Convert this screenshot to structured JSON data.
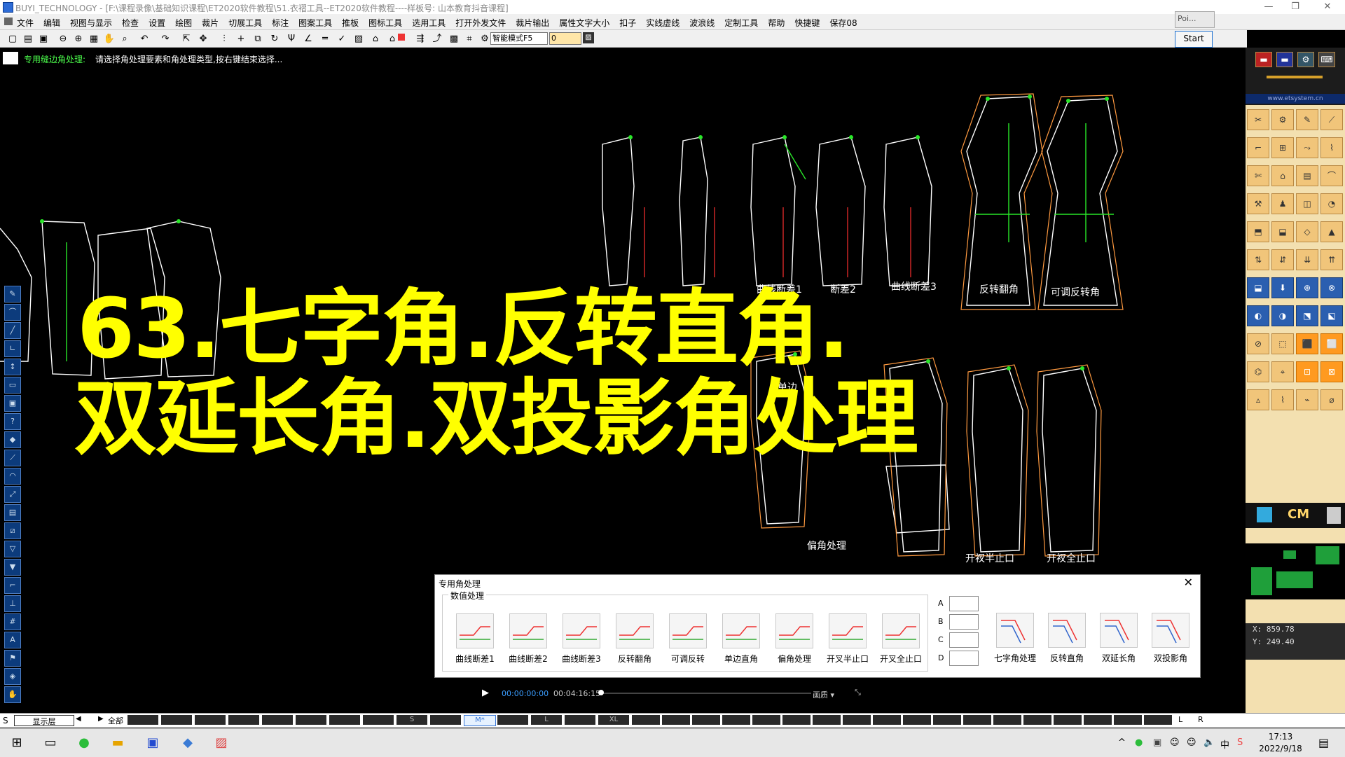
{
  "window": {
    "title": "BUYI_TECHNOLOGY - [F:\\课程录像\\基础知识课程\\ET2020软件教程\\51.衣褶工具--ET2020软件教程----样板号: 山本教育抖音课程]",
    "controls": [
      "—",
      "❐",
      "✕"
    ]
  },
  "menu": [
    "文件",
    "编辑",
    "视图与显示",
    "检查",
    "设置",
    "绘图",
    "裁片",
    "切展工具",
    "标注",
    "图案工具",
    "推板",
    "图标工具",
    "选用工具",
    "打开外发文件",
    "裁片输出",
    "属性文字大小",
    "扣子",
    "实线虚线",
    "波浪线",
    "定制工具",
    "帮助",
    "快捷键",
    "保存08"
  ],
  "toolbar": {
    "mode_select": "智能模式F5",
    "num_value": "0"
  },
  "floating": {
    "poi_label": "Poi...",
    "start_label": "Start"
  },
  "prompt": {
    "label": "专用缝边角处理:",
    "text": "请选择角处理要素和角处理类型,按右键结束选择..."
  },
  "headline": {
    "line1": "63.七字角.反转直角.",
    "line2": "双延长角.双投影角处理"
  },
  "canvas_labels": {
    "curve_diff1": "曲线断差1",
    "curve_diff2": "断差2",
    "curve_diff3": "曲线断差3",
    "flip_corner": "反转翻角",
    "adj_flip": "可调反转角",
    "single_side": "单边",
    "offset_corner": "偏角处理",
    "half_slit": "开衩半止口",
    "full_slit": "开衩全止口"
  },
  "dialog": {
    "title": "专用角处理",
    "close": "✕",
    "group_label": "数值处理",
    "buttons": [
      "曲线断差1",
      "曲线断差2",
      "曲线断差3",
      "反转翻角",
      "可调反转",
      "单边直角",
      "偏角处理",
      "开叉半止口",
      "开叉全止口"
    ],
    "params": [
      "A",
      "B",
      "C",
      "D"
    ],
    "right_buttons": [
      "七字角处理",
      "反转直角",
      "双延长角",
      "双投影角"
    ]
  },
  "video": {
    "current": "00:00:00:00",
    "total": "00:04:16:15",
    "quality": "画质 ▾"
  },
  "right_panel": {
    "url": "www.etsystem.cn",
    "unit": "CM",
    "x_label": "X:",
    "x_value": "859.78",
    "y_label": "Y:",
    "y_value": "249.40"
  },
  "sizebar": {
    "left_tag": "S",
    "layer": "显示层",
    "all": "全部",
    "sizes": [
      "",
      "",
      "",
      "",
      "",
      "",
      "",
      "",
      "S",
      "",
      "M*",
      "",
      "L",
      "",
      "XL"
    ],
    "right_tags": [
      "L",
      "R"
    ]
  },
  "taskbar": {
    "time": "17:13",
    "date": "2022/9/18"
  },
  "colors": {
    "headline": "#ffff00",
    "pattern_line": "#ffffff",
    "seam_line": "#ff9a40",
    "point": "#29e629",
    "dart": "#ff3030"
  }
}
